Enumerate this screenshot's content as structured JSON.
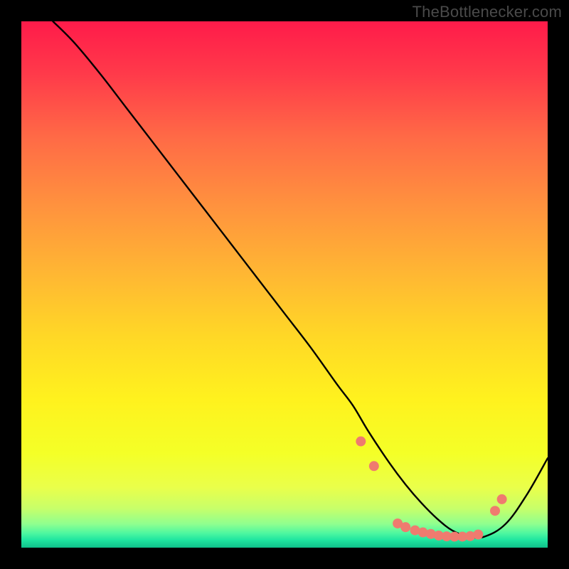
{
  "attribution": "TheBottlenecker.com",
  "chart_data": {
    "type": "line",
    "title": "",
    "xlabel": "",
    "ylabel": "",
    "xlim": [
      0,
      100
    ],
    "ylim": [
      0,
      100
    ],
    "series": [
      {
        "name": "curve",
        "x": [
          6,
          10,
          15,
          20,
          25,
          30,
          35,
          40,
          45,
          50,
          55,
          60,
          63,
          66,
          70,
          73,
          76,
          79,
          82,
          85,
          88,
          92,
          96,
          100
        ],
        "y": [
          100,
          96,
          90,
          83.5,
          77,
          70.5,
          64,
          57.5,
          51,
          44.5,
          38,
          31,
          27,
          22,
          16,
          12,
          8.5,
          5.5,
          3.2,
          2.1,
          2.1,
          4.5,
          10,
          17
        ],
        "color": "#000000",
        "width": 2.4
      }
    ],
    "markers": {
      "name": "dots",
      "points": [
        {
          "x": 64.5,
          "y": 20.2
        },
        {
          "x": 67.0,
          "y": 15.5
        },
        {
          "x": 71.5,
          "y": 4.6
        },
        {
          "x": 73.0,
          "y": 3.9
        },
        {
          "x": 74.8,
          "y": 3.3
        },
        {
          "x": 76.3,
          "y": 2.9
        },
        {
          "x": 77.8,
          "y": 2.6
        },
        {
          "x": 79.3,
          "y": 2.3
        },
        {
          "x": 80.8,
          "y": 2.15
        },
        {
          "x": 82.3,
          "y": 2.1
        },
        {
          "x": 83.8,
          "y": 2.1
        },
        {
          "x": 85.3,
          "y": 2.2
        },
        {
          "x": 86.8,
          "y": 2.5
        },
        {
          "x": 90.0,
          "y": 7.0
        },
        {
          "x": 91.3,
          "y": 9.2
        }
      ],
      "color": "#ef7b6f",
      "radius": 7
    },
    "background_gradient": {
      "stops": [
        {
          "offset": 0.0,
          "color": "#ff1b4a"
        },
        {
          "offset": 0.1,
          "color": "#ff3a4a"
        },
        {
          "offset": 0.22,
          "color": "#ff6a46"
        },
        {
          "offset": 0.35,
          "color": "#ff923e"
        },
        {
          "offset": 0.48,
          "color": "#ffb733"
        },
        {
          "offset": 0.6,
          "color": "#ffd826"
        },
        {
          "offset": 0.72,
          "color": "#fff21e"
        },
        {
          "offset": 0.82,
          "color": "#f4ff27"
        },
        {
          "offset": 0.885,
          "color": "#eaff4a"
        },
        {
          "offset": 0.925,
          "color": "#c8ff69"
        },
        {
          "offset": 0.955,
          "color": "#8fff8f"
        },
        {
          "offset": 0.973,
          "color": "#4cf7a0"
        },
        {
          "offset": 0.985,
          "color": "#20e6a0"
        },
        {
          "offset": 1.0,
          "color": "#0fc08a"
        }
      ]
    }
  }
}
